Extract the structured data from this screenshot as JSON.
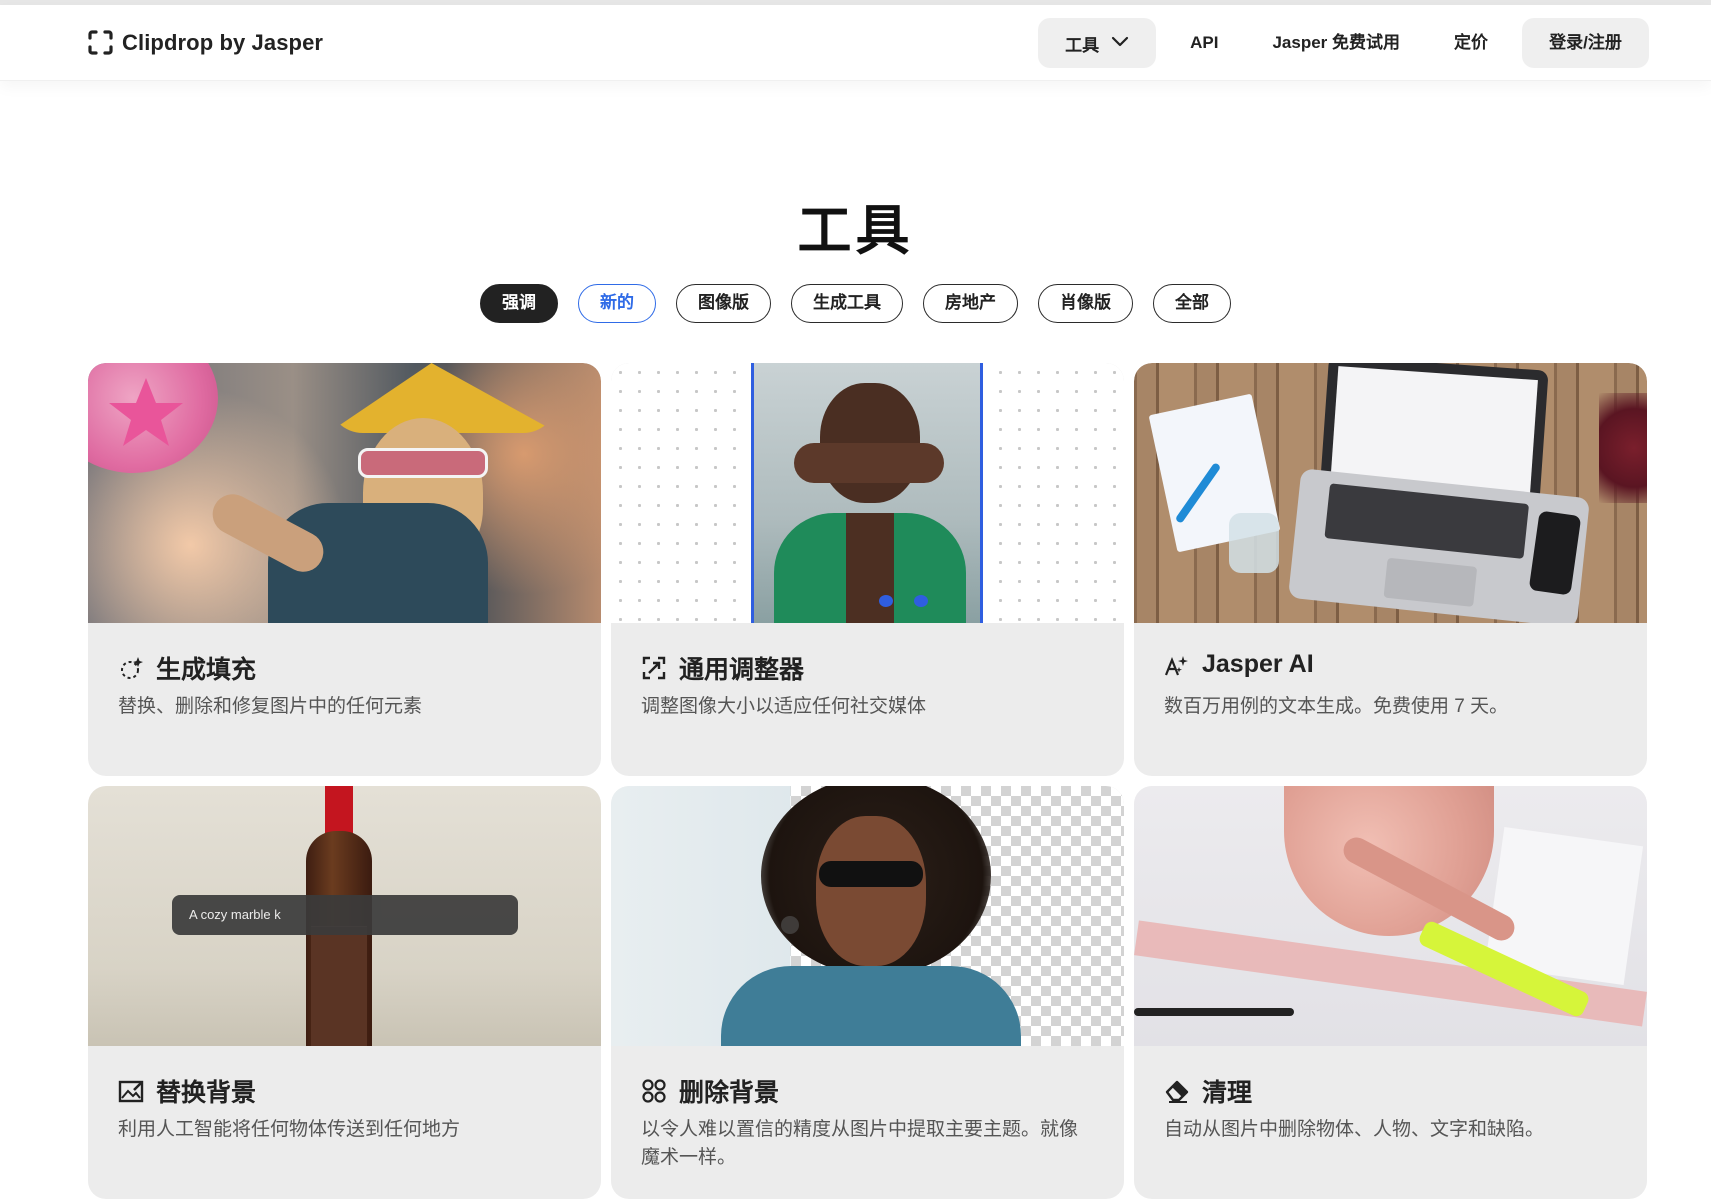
{
  "header": {
    "logo_text": "Clipdrop by Jasper",
    "nav": {
      "tools_label": "工具",
      "api_label": "API",
      "trial_label": "Jasper 免费试用",
      "pricing_label": "定价",
      "login_label": "登录/注册"
    }
  },
  "main": {
    "title": "工具",
    "filters": [
      "强调",
      "新的",
      "图像版",
      "生成工具",
      "房地产",
      "肖像版",
      "全部"
    ],
    "active_filter": "强调",
    "cards": [
      {
        "title": "生成填充",
        "desc": "替换、删除和修复图片中的任何元素",
        "icon": "sparkle-icon"
      },
      {
        "title": "通用调整器",
        "desc": "调整图像大小以适应任何社交媒体",
        "icon": "resize-icon"
      },
      {
        "title": "Jasper AI",
        "desc": "数百万用例的文本生成。免费使用 7 天。",
        "icon": "ai-text-icon"
      },
      {
        "title": "替换背景",
        "desc": "利用人工智能将任何物体传送到任何地方",
        "icon": "image-edit-icon",
        "img_caption": "A cozy marble k"
      },
      {
        "title": "删除背景",
        "desc": "以令人难以置信的精度从图片中提取主要主题。就像魔术一样。",
        "icon": "scissors-icon"
      },
      {
        "title": "清理",
        "desc": "自动从图片中删除物体、人物、文字和缺陷。",
        "icon": "eraser-icon"
      }
    ]
  },
  "colors": {
    "accent_blue": "#2f6be7",
    "card_bg": "#ececec",
    "chip_active": "#222222"
  }
}
